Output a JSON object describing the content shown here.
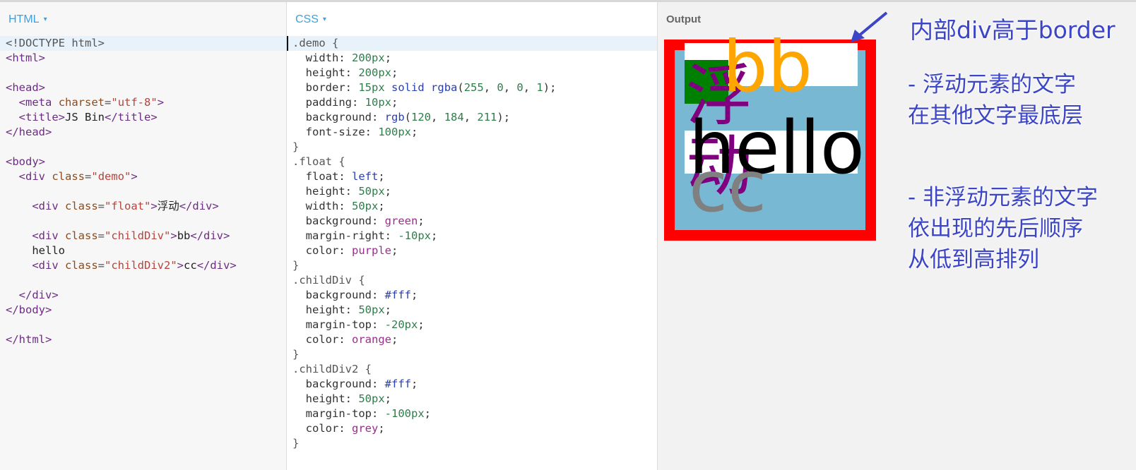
{
  "panels": {
    "html_label": "HTML",
    "css_label": "CSS",
    "output_label": "Output",
    "dropdown_glyph": "▾"
  },
  "html_code": [
    "<!DOCTYPE html>",
    "<html>",
    "",
    "<head>",
    "  <meta charset=\"utf-8\">",
    "  <title>JS Bin</title>",
    "</head>",
    "",
    "<body>",
    "  <div class=\"demo\">",
    "",
    "    <div class=\"float\">浮动</div>",
    "",
    "    <div class=\"childDiv\">bb</div>",
    "    hello",
    "    <div class=\"childDiv2\">cc</div>",
    "",
    "  </div>",
    "</body>",
    "",
    "</html>"
  ],
  "css_code": [
    ".demo {",
    "  width: 200px;",
    "  height: 200px;",
    "  border: 15px solid rgba(255, 0, 0, 1);",
    "  padding: 10px;",
    "  background: rgb(120, 184, 211);",
    "  font-size: 100px;",
    "}",
    ".float {",
    "  float: left;",
    "  height: 50px;",
    "  width: 50px;",
    "  background: green;",
    "  margin-right: -10px;",
    "  color: purple;",
    "}",
    ".childDiv {",
    "  background: #fff;",
    "  height: 50px;",
    "  margin-top: -20px;",
    "  color: orange;",
    "}",
    ".childDiv2 {",
    "  background: #fff;",
    "  height: 50px;",
    "  margin-top: -100px;",
    "  color: grey;",
    "}"
  ],
  "output": {
    "float_text": "浮动",
    "bb_text": "bb",
    "hello_text": "hello",
    "cc_text": "cc"
  },
  "annotations": {
    "title": "内部div高于border",
    "note1_line1": "- 浮动元素的文字",
    "note1_line2": "在其他文字最底层",
    "note2_line1": "- 非浮动元素的文字",
    "note2_line2": "依出现的先后顺序",
    "note2_line3": "从低到高排列"
  },
  "colors": {
    "annotation": "#3b45c6",
    "panel_label": "#3ea1dd",
    "border_red": "#ff0000",
    "demo_bg": "#78b8d3"
  }
}
